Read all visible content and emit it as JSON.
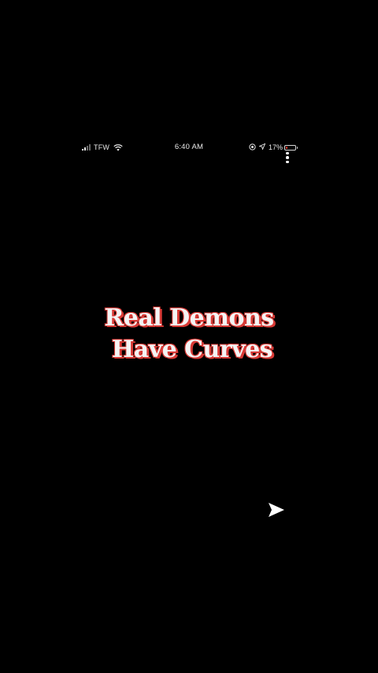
{
  "status_bar": {
    "carrier": "TFW",
    "time": "6:40 AM",
    "battery_percent": "17%",
    "battery_level": 0.17,
    "battery_color": "#e33b2e",
    "icons": [
      "signal-icon",
      "wifi-icon",
      "orientation-lock-icon",
      "location-arrow-icon",
      "battery-icon"
    ]
  },
  "post": {
    "title_line_1": "Real Demons",
    "title_line_2": "Have Curves",
    "title_text_color": "#f4f4f4",
    "title_outline_color": "#d83a36"
  },
  "actions": {
    "more_icon": "more-vertical-icon",
    "send_icon": "send-icon"
  }
}
